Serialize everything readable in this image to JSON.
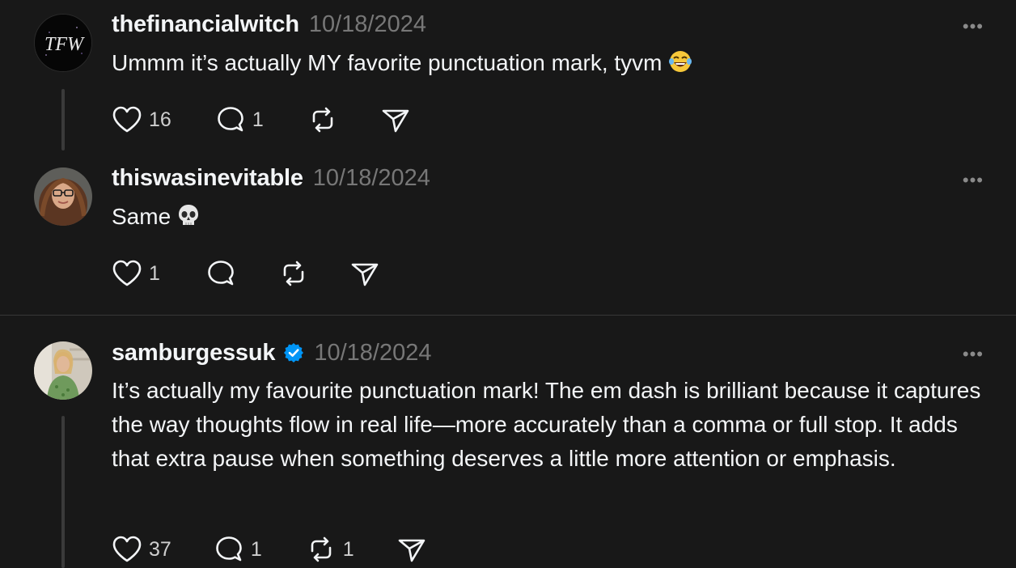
{
  "posts": [
    {
      "username": "thefinancialwitch",
      "date": "10/18/2024",
      "avatar_text": "TFW",
      "verified": false,
      "text": "Ummm it’s actually MY favorite punctuation mark, tyvm",
      "emoji": "laughing-tears",
      "more": "•••",
      "likes": "16",
      "replies": "1",
      "reposts": ""
    },
    {
      "username": "thiswasinevitable",
      "date": "10/18/2024",
      "verified": false,
      "text": "Same",
      "emoji": "skull",
      "more": "•••",
      "likes": "1",
      "replies": "",
      "reposts": ""
    },
    {
      "username": "samburgessuk",
      "date": "10/18/2024",
      "verified": true,
      "text": "It’s actually my favourite punctuation mark! The em dash is brilliant because it captures the way thoughts flow in real life—more accurately than a comma or full stop. It adds that extra pause when something deserves a little more attention or emphasis.",
      "more": "•••",
      "likes": "37",
      "replies": "1",
      "reposts": "1"
    }
  ],
  "colors": {
    "background": "#181818",
    "text": "#f3f5f7",
    "muted": "#777777",
    "verified": "#0095f6",
    "thread_line": "#3a3a3a"
  }
}
